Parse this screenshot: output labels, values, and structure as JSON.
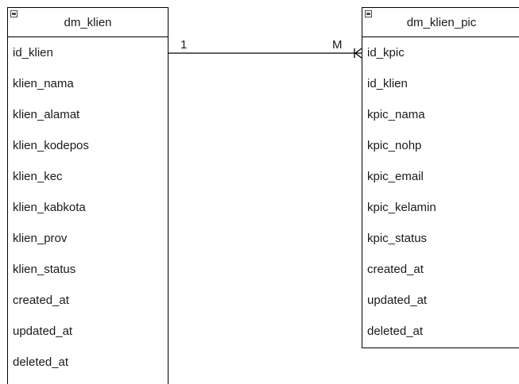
{
  "entities": {
    "klien": {
      "title": "dm_klien",
      "attributes": [
        "id_klien",
        "klien_nama",
        "klien_alamat",
        "klien_kodepos",
        "klien_kec",
        "klien_kabkota",
        "klien_prov",
        "klien_status",
        "created_at",
        "updated_at",
        "deleted_at"
      ]
    },
    "pic": {
      "title": "dm_klien_pic",
      "attributes": [
        "id_kpic",
        "id_klien",
        "kpic_nama",
        "kpic_nohp",
        "kpic_email",
        "kpic_kelamin",
        "kpic_status",
        "created_at",
        "updated_at",
        "deleted_at"
      ]
    }
  },
  "relationship": {
    "from_cardinality": "1",
    "to_cardinality": "M",
    "from_attribute": "id_klien",
    "to_attribute": "id_kpic"
  },
  "colors": {
    "line": "#000000",
    "text": "#1a1a1a",
    "background": "#ffffff"
  }
}
